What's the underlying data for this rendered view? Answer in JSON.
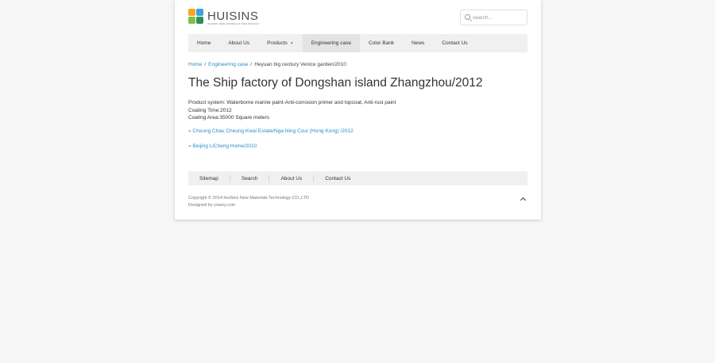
{
  "brand": {
    "name": "HUISINS",
    "tagline": "HUISINS NEW MATERIALS TECHNOLOGY",
    "colors": [
      "#f5a623",
      "#3aa0d8",
      "#7cc142",
      "#2f8f5a"
    ]
  },
  "search": {
    "placeholder": "search...",
    "value": "",
    "icon": "search-icon"
  },
  "nav": {
    "items": [
      {
        "label": "Home"
      },
      {
        "label": "About Us"
      },
      {
        "label": "Products"
      },
      {
        "label": "Engineering case"
      },
      {
        "label": "Color Bank"
      },
      {
        "label": "News"
      },
      {
        "label": "Contact Us"
      }
    ],
    "active": "Engineering case",
    "dropdown_icon": "chevron-down-icon"
  },
  "breadcrumb": {
    "home": "Home",
    "separator": "/",
    "section": "Engineering case",
    "current": "Heyuan big century Venice garden/2010"
  },
  "article": {
    "title": "The Ship factory of Dongshan island Zhangzhou/2012",
    "lines": [
      "Product system: Waterborne marine paint-Anti-corrosion primer and topcoat, Anti-rust paint",
      "Coating Time:2012",
      "Coating Area:35000 Square meters"
    ]
  },
  "pagination": {
    "prev": "« Cheung Chau Cheung Kwai Estate/Nga Ning Cour (Hong Kong) /2012",
    "next": "» Beijing LiCheng Home/2010"
  },
  "footer": {
    "links": [
      {
        "label": "Sitemap"
      },
      {
        "label": "Search"
      },
      {
        "label": "About Us"
      },
      {
        "label": "Contact Us"
      }
    ],
    "copyright": "Copyright © 2014 HuiSins New Materials Technology CO.,LTD",
    "designed_by": "Designed by yowey.com",
    "back_to_top_icon": "chevron-up-icon"
  },
  "colors": {
    "link": "#2a8fc6",
    "nav_bg": "#f0f0f0",
    "nav_active_bg": "#e4e4e4",
    "page_bg": "#f6f6f7"
  }
}
